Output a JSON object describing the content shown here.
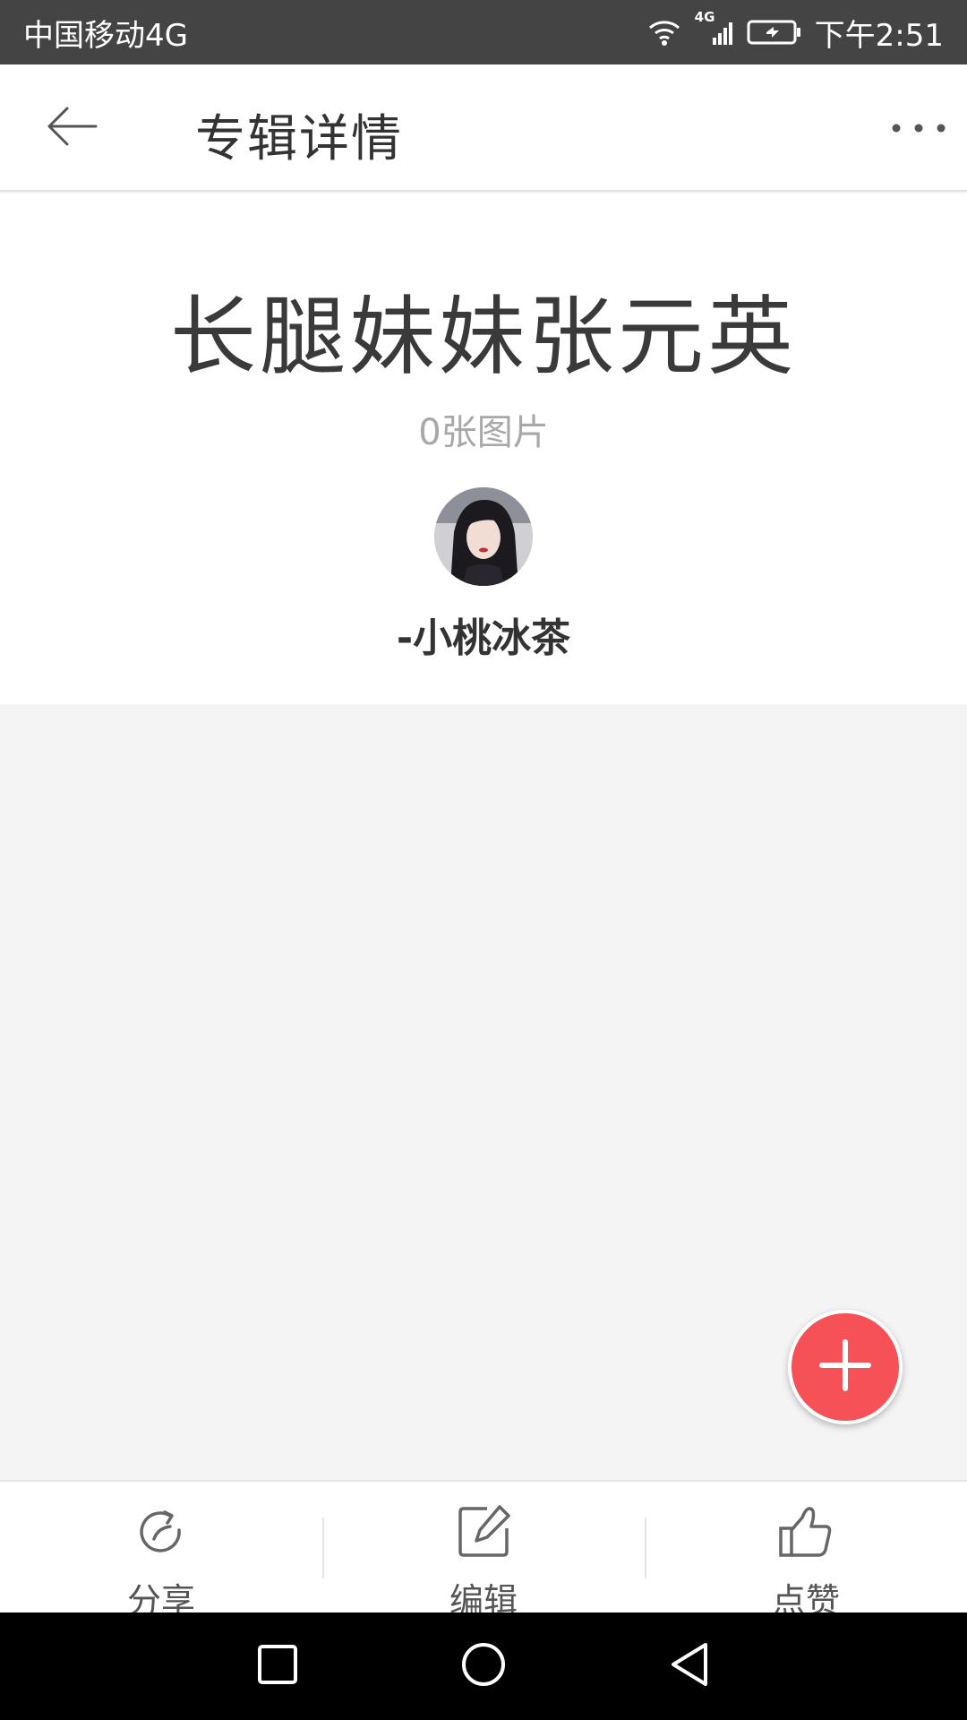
{
  "status_bar": {
    "carrier": "中国移动4G",
    "network_badge": "4G",
    "time": "下午2:51",
    "icons": [
      "wifi-icon",
      "cellular-signal-icon",
      "battery-icon"
    ]
  },
  "app_bar": {
    "title": "专辑详情",
    "icons": [
      "back-arrow-icon",
      "more-options-icon"
    ]
  },
  "album": {
    "title": "长腿妹妹张元英",
    "photo_count": "0张图片",
    "author": "-小桃冰茶"
  },
  "fab": {
    "icon": "plus-icon",
    "color": "#f55157"
  },
  "bottom_actions": [
    {
      "label": "分享",
      "icon": "share-icon"
    },
    {
      "label": "编辑",
      "icon": "edit-icon"
    },
    {
      "label": "点赞",
      "icon": "thumbs-up-icon"
    }
  ],
  "nav_bar": {
    "icons": [
      "recent-apps-icon",
      "home-icon",
      "back-icon"
    ]
  },
  "colors": {
    "status_bar": "#444444",
    "accent": "#f55157",
    "background": "#f4f4f4"
  }
}
